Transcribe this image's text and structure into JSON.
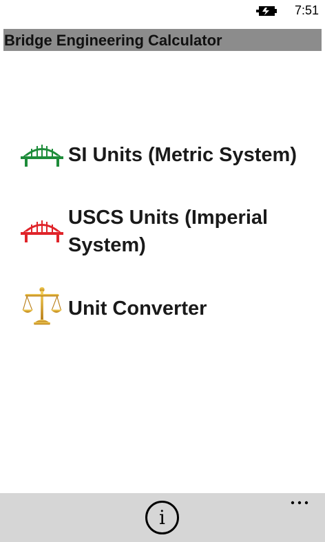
{
  "status_bar": {
    "time": "7:51",
    "battery_icon": "battery-charging-icon"
  },
  "header": {
    "title": "Bridge Engineering Calculator"
  },
  "menu": {
    "items": [
      {
        "label": "SI Units (Metric System)",
        "icon": "green-bridge-icon",
        "icon_color": "#1e8c3a"
      },
      {
        "label": "USCS Units (Imperial System)",
        "icon": "red-bridge-icon",
        "icon_color": "#e0242a"
      },
      {
        "label": "Unit Converter",
        "icon": "scales-icon",
        "icon_color": "#d9a01a"
      }
    ]
  },
  "app_bar": {
    "info_icon": "info-icon",
    "info_glyph": "i",
    "more_icon": "ellipsis-icon"
  }
}
